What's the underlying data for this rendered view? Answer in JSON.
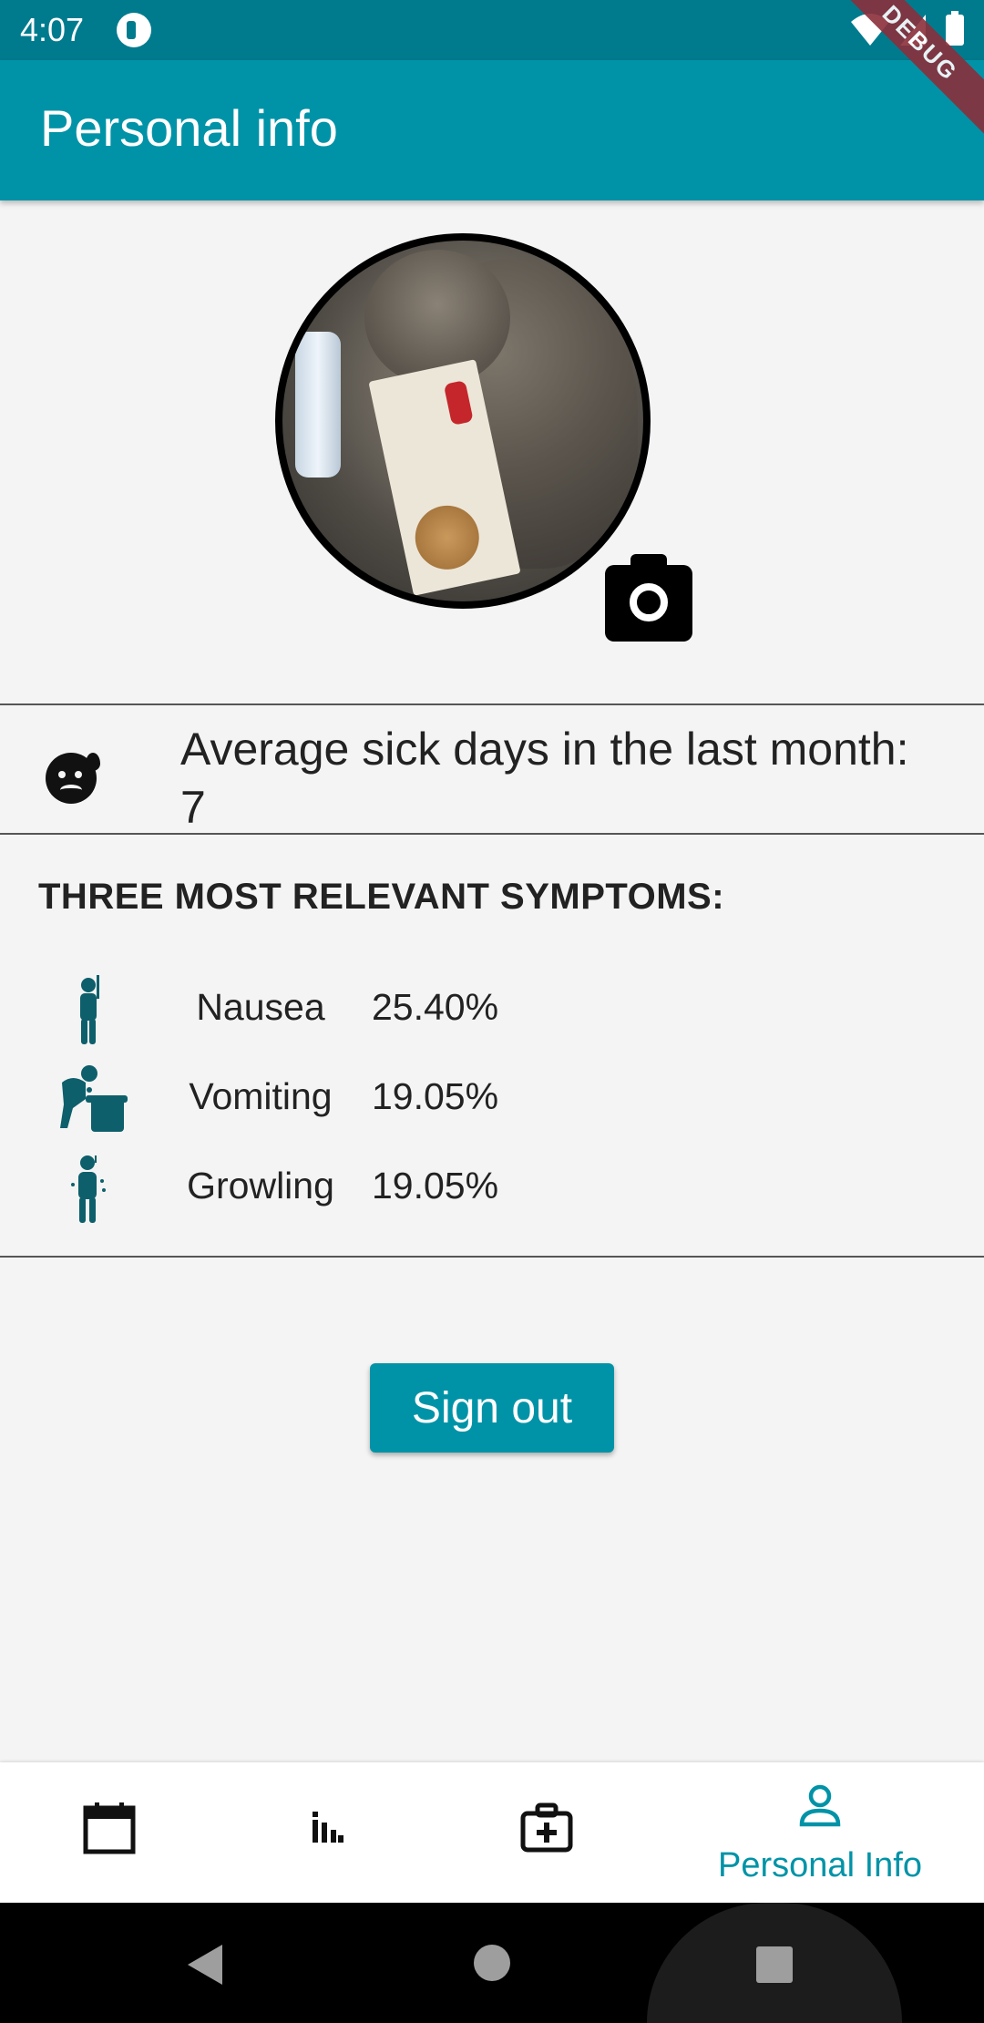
{
  "status_bar": {
    "time": "4:07"
  },
  "debug_banner": "DEBUG",
  "app_bar": {
    "title": "Personal info"
  },
  "profile": {
    "sick_days_text": "Average sick days in the last month: 7"
  },
  "symptoms": {
    "heading": "THREE MOST RELEVANT SYMPTOMS:",
    "items": [
      {
        "name": "Nausea",
        "percent": "25.40%"
      },
      {
        "name": "Vomiting",
        "percent": "19.05%"
      },
      {
        "name": "Growling",
        "percent": "19.05%"
      }
    ]
  },
  "actions": {
    "sign_out_label": "Sign out"
  },
  "bottom_nav": {
    "items": [
      {
        "icon": "calendar-icon",
        "label": ""
      },
      {
        "icon": "bar-chart-icon",
        "label": ""
      },
      {
        "icon": "medical-kit-icon",
        "label": ""
      },
      {
        "icon": "person-icon",
        "label": "Personal Info",
        "active": true
      }
    ]
  },
  "colors": {
    "primary": "#0093a7",
    "status_bar": "#007b8e",
    "symptom_icon": "#0d5f6b",
    "background": "#f4f4f4"
  }
}
